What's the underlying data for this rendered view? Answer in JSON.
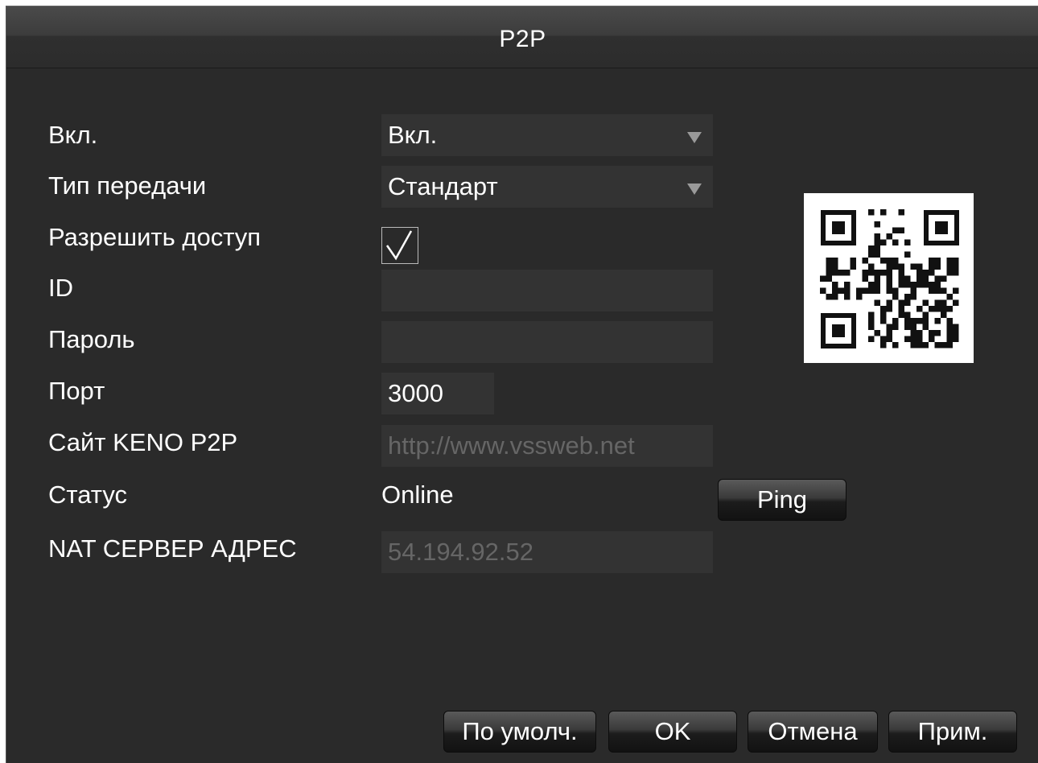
{
  "window": {
    "title": "P2P"
  },
  "form": {
    "enable": {
      "label": "Вкл.",
      "value": "Вкл."
    },
    "transfer_type": {
      "label": "Тип передачи",
      "value": "Стандарт"
    },
    "allow_access": {
      "label": "Разрешить доступ",
      "checked": true
    },
    "id": {
      "label": "ID",
      "value": ""
    },
    "password": {
      "label": "Пароль",
      "value": ""
    },
    "port": {
      "label": "Порт",
      "value": "3000"
    },
    "site": {
      "label": "Сайт KENO P2P",
      "value": "http://www.vssweb.net"
    },
    "status": {
      "label": "Статус",
      "value": "Online",
      "ping_label": "Ping"
    },
    "nat": {
      "label": "NAT СЕРВЕР АДРЕС",
      "value": "54.194.92.52"
    }
  },
  "buttons": {
    "default": "По умолч.",
    "ok": "OK",
    "cancel": "Отмена",
    "apply": "Прим."
  },
  "icons": {
    "dropdown": "chevron-down-icon",
    "check": "checkmark-icon",
    "qr": "qr-code-icon"
  },
  "colors": {
    "panel": "#2a2a2a",
    "field": "#333333",
    "text": "#ffffff",
    "dim_text": "#666666"
  }
}
